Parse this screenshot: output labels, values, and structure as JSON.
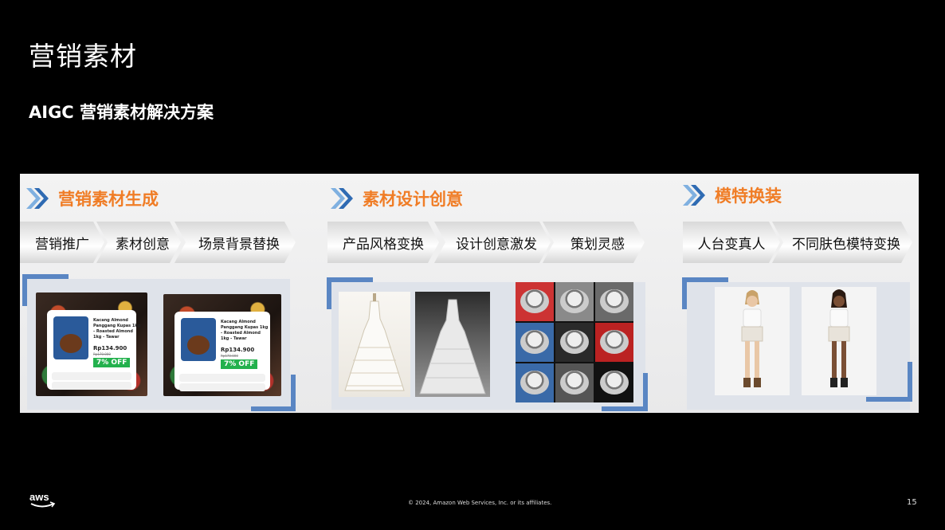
{
  "slide": {
    "title": "营销素材",
    "subtitle": "AIGC 营销素材解决方案",
    "footer_copyright": "© 2024, Amazon Web Services, Inc. or its affiliates.",
    "page_number": "15",
    "logo_text": "aws"
  },
  "sections": [
    {
      "title": "营销素材生成",
      "tags": [
        "营销推广",
        "素材创意",
        "场景背景替换"
      ]
    },
    {
      "title": "素材设计创意",
      "tags": [
        "产品风格变换",
        "设计创意激发",
        "策划灵感"
      ]
    },
    {
      "title": "模特换装",
      "tags": [
        "人台变真人",
        "不同肤色模特变换"
      ]
    }
  ],
  "product_cards": [
    {
      "name": "Kacang Almond Panggang Kupas 1kg - Roasted Almond 1kg - Tawar",
      "price": "Rp134.900",
      "old_price": "Rp170.000",
      "discount": "7% OFF"
    },
    {
      "name": "Kacang Almond Panggang Kupas 1kg - Roasted Almond 1kg - Tawar",
      "price": "Rp134.900",
      "old_price": "Rp170.000",
      "discount": "7% OFF"
    }
  ],
  "colors": {
    "accent_orange": "#f07d26",
    "frame_blue": "#5a86c3",
    "discount_green": "#23b14d"
  },
  "icons": {
    "section_marker": "double-chevron-right-icon"
  }
}
